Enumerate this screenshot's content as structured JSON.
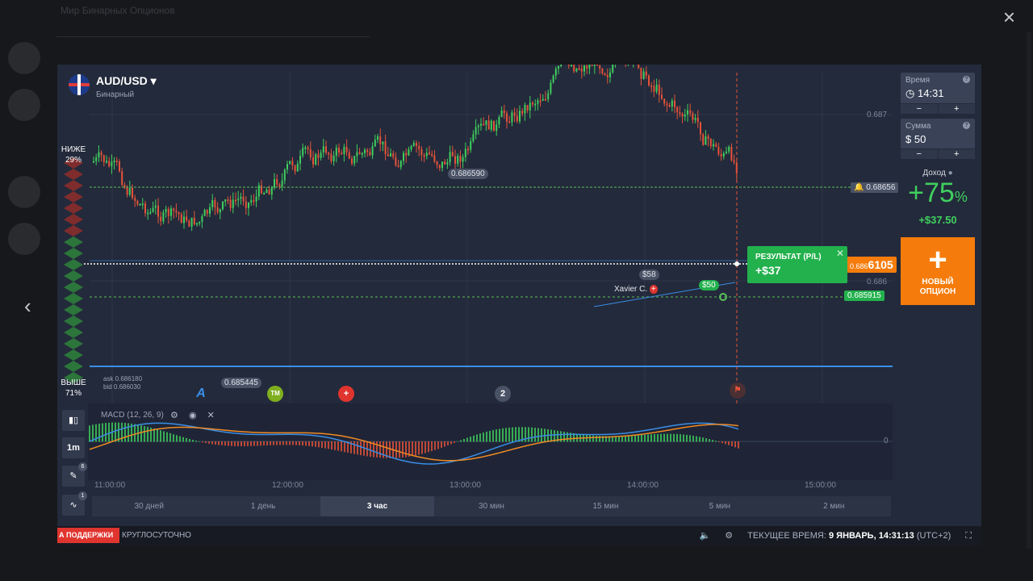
{
  "background": {
    "title": "Мир Бинарных Опционов",
    "close_icon": "×",
    "back_arrow": "‹"
  },
  "asset": {
    "pair": "AUD/USD",
    "dropdown": "▾",
    "type": "Бинарный"
  },
  "sentiment": {
    "down_label": "НИЖЕ",
    "down_pct": "29%",
    "up_label": "ВЫШЕ",
    "up_pct": "71%",
    "ask": "ask 0.686180",
    "bid": "bid 0.686030"
  },
  "price_labels": {
    "high_mark": "0.686590",
    "low_mark": "0.685445",
    "axis_687": "0.687",
    "axis_686": "0.686",
    "strike_alert": "0.68656",
    "current_price": "6105",
    "current_prefix": "0.686",
    "green_level": "0.685915"
  },
  "trade": {
    "result_title": "РЕЗУЛЬТАТ (P/L)",
    "result_value": "+$37",
    "bubble_58": "$58",
    "bubble_50": "$50",
    "trader_name": "Xavier C."
  },
  "panel": {
    "time_label": "Время",
    "time_value": "14:31",
    "amount_label": "Сумма",
    "amount_value": "$  50",
    "minus": "−",
    "plus": "+",
    "help": "?",
    "profit_label": "Доход",
    "profit_pct": "+75",
    "profit_pct_sign": "%",
    "profit_amount": "+$37.50",
    "new_option_line1": "НОВЫЙ",
    "new_option_line2": "ОПЦИОН",
    "new_option_plus": "+"
  },
  "tools": {
    "timeframe": "1m",
    "draw_badge": "6",
    "indicator_badge": "1"
  },
  "markers": {
    "count": "2"
  },
  "indicator": {
    "label": "MACD (12, 26, 9)",
    "zero": "0"
  },
  "time_axis": [
    "11:00:00",
    "12:00:00",
    "13:00:00",
    "14:00:00",
    "15:00:00"
  ],
  "periods": [
    {
      "label": "30 дней",
      "active": false
    },
    {
      "label": "1 день",
      "active": false
    },
    {
      "label": "3 час",
      "active": true
    },
    {
      "label": "30 мин",
      "active": false
    },
    {
      "label": "15 мин",
      "active": false
    },
    {
      "label": "5 мин",
      "active": false
    },
    {
      "label": "2 мин",
      "active": false
    }
  ],
  "statusbar": {
    "support": "А ПОДДЕРЖКИ",
    "allday": "КРУГЛОСУТОЧНО",
    "current_time_label": "ТЕКУЩЕЕ ВРЕМЯ:",
    "current_time_value": "9 ЯНВАРЬ, 14:31:13",
    "timezone": "(UTC+2)"
  },
  "colors": {
    "up": "#3fcf5e",
    "down": "#e5533a",
    "accent": "#f57c0c",
    "macd": "#3a8ee6",
    "signal": "#f08a24"
  }
}
